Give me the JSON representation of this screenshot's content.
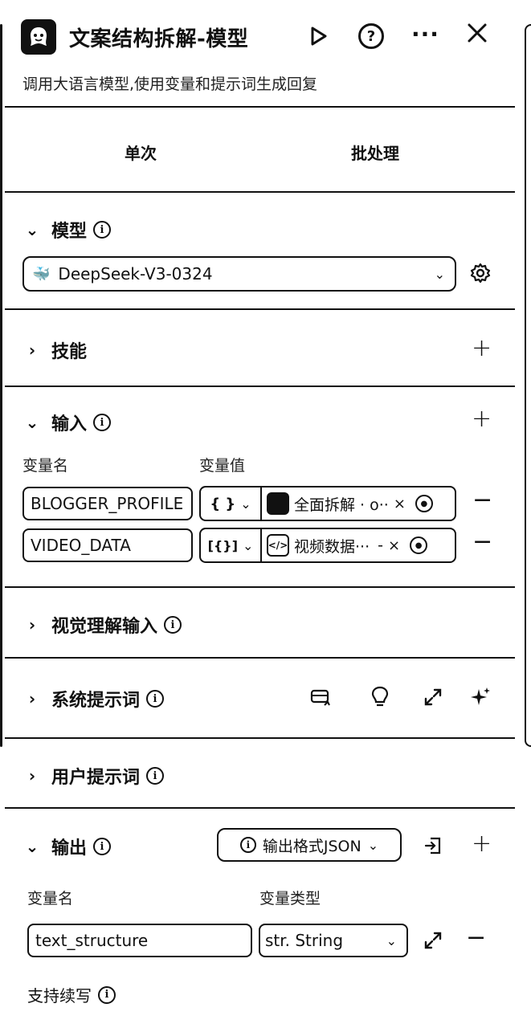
{
  "header": {
    "title": "文案结构拆解-模型",
    "subtitle": "调用大语言模型,使用变量和提示词生成回复"
  },
  "tabs": [
    "单次",
    "批处理"
  ],
  "model_section": {
    "title": "模型",
    "selected_model": "DeepSeek-V3-0324"
  },
  "skills_section": {
    "title": "技能"
  },
  "input_section": {
    "title": "输入",
    "col_name": "变量名",
    "col_value": "变量值",
    "rows": [
      {
        "name": "BLOGGER_PROFILE",
        "type_icon": "{ }",
        "value": "全面拆解 · o··",
        "remove": "×"
      },
      {
        "name": "VIDEO_DATA",
        "type_icon": "[{}]",
        "value": "视频数据···",
        "suffix": "-",
        "remove": "×"
      }
    ]
  },
  "vision_section": {
    "title": "视觉理解输入"
  },
  "system_prompt_section": {
    "title": "系统提示词"
  },
  "user_prompt_section": {
    "title": "用户提示词"
  },
  "output_section": {
    "title": "输出",
    "format_label": "输出格式JSON",
    "col_name": "变量名",
    "col_type": "变量类型",
    "var_name": "text_structure",
    "var_type": "str. String",
    "continue_label": "支持续写"
  }
}
